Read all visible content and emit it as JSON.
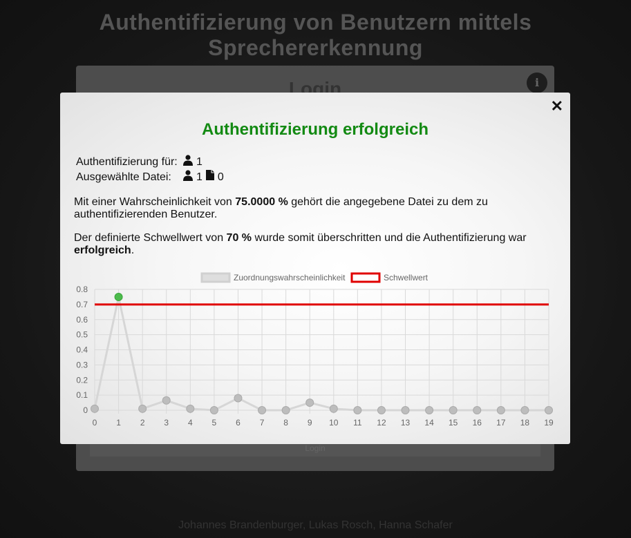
{
  "page": {
    "title": "Authentifizierung von Benutzern mittels Sprechererkennung",
    "footer": "Johannes Brandenburger, Lukas Rosch, Hanna Schafer"
  },
  "login_card": {
    "title": "Login",
    "info_icon": "info-icon",
    "bar_label": "Login"
  },
  "modal": {
    "close_label": "✕",
    "title": "Authentifizierung erfolgreich",
    "auth_for_label": "Authentifizierung für:",
    "auth_for_user": "1",
    "selected_file_label": "Ausgewählte Datei:",
    "selected_user": "1",
    "selected_file": "0",
    "para1_prefix": "Mit einer Wahrscheinlichkeit von ",
    "para1_value": "75.0000 %",
    "para1_suffix": " gehört die angegebene Datei zu dem zu authentifizierenden Benutzer.",
    "para2_prefix": "Der definierte Schwellwert von ",
    "para2_value": "70 %",
    "para2_mid": " wurde somit überschritten und die Authentifizierung war ",
    "para2_bold": "erfolgreich",
    "para2_end": ".",
    "colors": {
      "success": "#138a13",
      "threshold": "#e00000",
      "point_match": "#4cba4c",
      "point": "#bdbdbd"
    },
    "icons": {
      "user": "user-icon",
      "file": "file-icon"
    }
  },
  "chart_data": {
    "type": "line",
    "x": [
      0,
      1,
      2,
      3,
      4,
      5,
      6,
      7,
      8,
      9,
      10,
      11,
      12,
      13,
      14,
      15,
      16,
      17,
      18,
      19
    ],
    "series": [
      {
        "name": "Zuordnungswahrscheinlichkeit",
        "values": [
          0.01,
          0.75,
          0.01,
          0.065,
          0.01,
          0.0,
          0.08,
          0.0,
          0.0,
          0.05,
          0.01,
          0.0,
          0.0,
          0.0,
          0.0,
          0.0,
          0.0,
          0.0,
          0.0,
          0.0
        ]
      },
      {
        "name": "Schwellwert",
        "values": [
          0.7,
          0.7,
          0.7,
          0.7,
          0.7,
          0.7,
          0.7,
          0.7,
          0.7,
          0.7,
          0.7,
          0.7,
          0.7,
          0.7,
          0.7,
          0.7,
          0.7,
          0.7,
          0.7,
          0.7
        ]
      }
    ],
    "highlight_index": 1,
    "ylim": [
      0,
      0.8
    ],
    "yticks": [
      "0",
      "0.1",
      "0.2",
      "0.3",
      "0.4",
      "0.5",
      "0.6",
      "0.7",
      "0.8"
    ],
    "xticks": [
      "0",
      "1",
      "2",
      "3",
      "4",
      "5",
      "6",
      "7",
      "8",
      "9",
      "10",
      "11",
      "12",
      "13",
      "14",
      "15",
      "16",
      "17",
      "18",
      "19"
    ],
    "grid": true,
    "legend": "top"
  }
}
